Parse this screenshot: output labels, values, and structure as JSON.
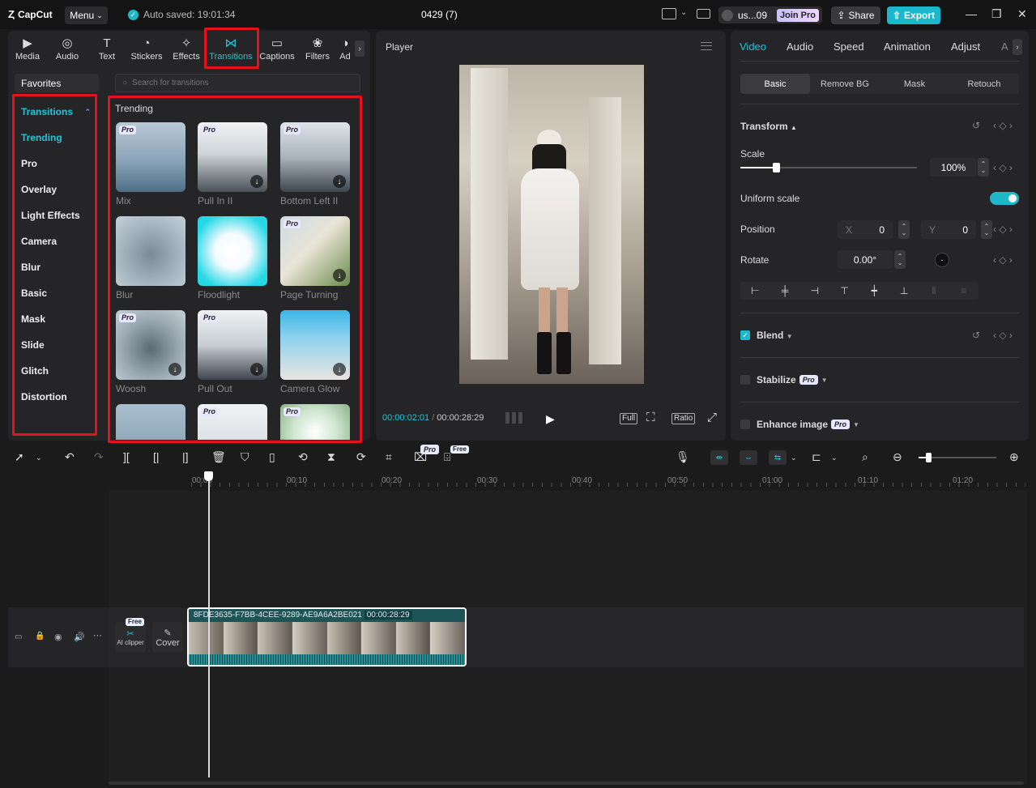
{
  "app": {
    "logo": "CapCut",
    "menu_label": "Menu",
    "autosave": "Auto saved: 19:01:34",
    "doc_title": "0429 (7)",
    "user": "us...09",
    "join_pro": "Join Pro",
    "share": "Share",
    "export": "Export",
    "accent": "#1fc6d8"
  },
  "left_tabs": [
    {
      "label": "Media",
      "icon": "media-icon"
    },
    {
      "label": "Audio",
      "icon": "audio-icon"
    },
    {
      "label": "Text",
      "icon": "text-icon"
    },
    {
      "label": "Stickers",
      "icon": "stickers-icon"
    },
    {
      "label": "Effects",
      "icon": "effects-icon"
    },
    {
      "label": "Transitions",
      "icon": "transitions-icon",
      "active": true
    },
    {
      "label": "Captions",
      "icon": "captions-icon"
    },
    {
      "label": "Filters",
      "icon": "filters-icon"
    },
    {
      "label": "Ad",
      "icon": "adjust-icon"
    }
  ],
  "favorites": "Favorites",
  "search_placeholder": "Search for transitions",
  "categories": {
    "header": "Transitions",
    "items": [
      "Trending",
      "Pro",
      "Overlay",
      "Light Effects",
      "Camera",
      "Blur",
      "Basic",
      "Mask",
      "Slide",
      "Glitch",
      "Distortion"
    ]
  },
  "section_title": "Trending",
  "transitions": [
    {
      "name": "Mix",
      "pro": true,
      "download": false
    },
    {
      "name": "Pull In II",
      "pro": true,
      "download": true
    },
    {
      "name": "Bottom Left II",
      "pro": true,
      "download": true
    },
    {
      "name": "Blur",
      "pro": false,
      "download": false
    },
    {
      "name": "Floodlight",
      "pro": false,
      "download": false
    },
    {
      "name": "Page Turning",
      "pro": true,
      "download": true
    },
    {
      "name": "Woosh",
      "pro": true,
      "download": true
    },
    {
      "name": "Pull Out",
      "pro": true,
      "download": true
    },
    {
      "name": "Camera Glow",
      "pro": false,
      "download": true
    }
  ],
  "pro_badge": "Pro",
  "free_badge": "Free",
  "player": {
    "title": "Player",
    "current": "00:00:02:01",
    "total": "00:00:28:29",
    "full": "Full",
    "ratio": "Ratio"
  },
  "right_tabs": [
    "Video",
    "Audio",
    "Speed",
    "Animation",
    "Adjust",
    "A"
  ],
  "video_segments": [
    "Basic",
    "Remove BG",
    "Mask",
    "Retouch"
  ],
  "transform": {
    "title": "Transform",
    "scale_label": "Scale",
    "scale_value": "100%",
    "scale_fraction": 0.2,
    "uniform_scale": "Uniform scale",
    "position_label": "Position",
    "x_label": "X",
    "x_value": "0",
    "y_label": "Y",
    "y_value": "0",
    "rotate_label": "Rotate",
    "rotate_value": "0.00°"
  },
  "blend": "Blend",
  "stabilize": "Stabilize",
  "enhance": "Enhance image",
  "timeline": {
    "ticks": [
      "00:00",
      "00:10",
      "00:20",
      "00:30",
      "00:40",
      "00:50",
      "01:00",
      "01:10",
      "01:20"
    ],
    "clip_name": "8FDE3635-F7BB-4CEE-9289-AE9A6A2BE021",
    "clip_duration": "00:00:28:29",
    "ai_clipper": "AI clipper",
    "cover": "Cover"
  }
}
